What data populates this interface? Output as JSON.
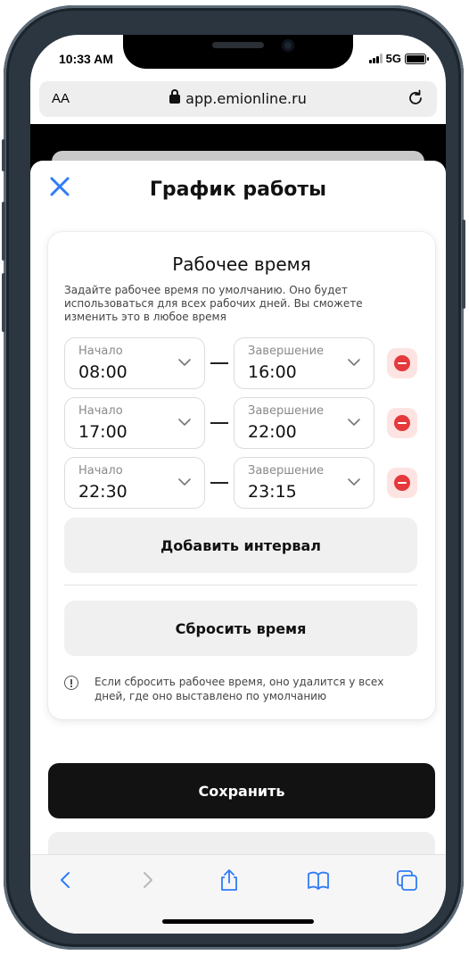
{
  "status_bar": {
    "time": "10:33 AM",
    "network": "5G"
  },
  "browser": {
    "text_size_label": "AA",
    "url": "app.emionline.ru",
    "icons": [
      "lock-icon",
      "reload-icon"
    ]
  },
  "sheet": {
    "title": "График работы",
    "close_icon": "close-icon",
    "accent_color": "#2f7cf6"
  },
  "work_time": {
    "title": "Рабочее время",
    "description": "Задайте рабочее время по умолчанию. Оно будет использоваться для всех рабочих дней. Вы сможете изменить это в любое время",
    "start_label": "Начало",
    "end_label": "Завершение",
    "intervals": [
      {
        "start": "08:00",
        "end": "16:00"
      },
      {
        "start": "17:00",
        "end": "22:00"
      },
      {
        "start": "22:30",
        "end": "23:15"
      }
    ],
    "add_interval_label": "Добавить интервал",
    "reset_label": "Сбросить время",
    "reset_note": "Если сбросить рабочее время, оно удалится у всех дней, где оно выставлено по умолчанию",
    "remove_color": "#e5393c"
  },
  "actions": {
    "save_label": "Сохранить"
  },
  "toolbar": {
    "items": [
      "back-icon",
      "forward-icon",
      "share-icon",
      "bookmarks-icon",
      "tabs-icon"
    ],
    "accent_color": "#2f7cf6"
  }
}
